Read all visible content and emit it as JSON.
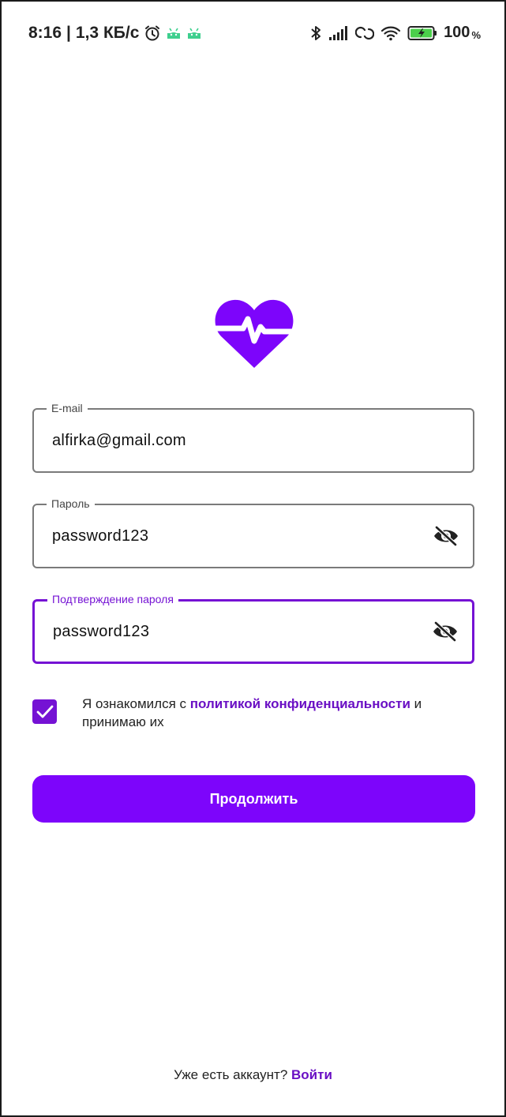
{
  "status_bar": {
    "time": "8:16",
    "separator": "|",
    "speed": "1,3 КБ/с",
    "battery_percent": "100",
    "battery_unit": "%",
    "icons_left": [
      "alarm-icon",
      "android-icon",
      "android-icon"
    ],
    "icons_right": [
      "bluetooth-icon",
      "signal-icon",
      "hotspot-icon",
      "wifi-icon",
      "battery-charging-icon"
    ]
  },
  "logo": {
    "icon": "heart-pulse-icon",
    "color": "#7d05fb"
  },
  "form": {
    "email": {
      "label": "E-mail",
      "value": "alfirka@gmail.com"
    },
    "password": {
      "label": "Пароль",
      "value": "password123",
      "toggle_icon": "eye-slash-icon"
    },
    "password_confirm": {
      "label": "Подтверждение пароля",
      "value": "password123",
      "toggle_icon": "eye-slash-icon",
      "focused": true
    }
  },
  "consent": {
    "checked": true,
    "text_before": "Я ознакомился с ",
    "link": "политикой конфиденциальности",
    "text_after": " и принимаю их"
  },
  "continue_button": {
    "label": "Продолжить"
  },
  "footer": {
    "prompt": "Уже есть аккаунт? ",
    "link": "Войти"
  },
  "colors": {
    "accent": "#7d05fb",
    "link": "#6a0fc4",
    "focus": "#7512d4",
    "border": "#7a7a7a"
  }
}
